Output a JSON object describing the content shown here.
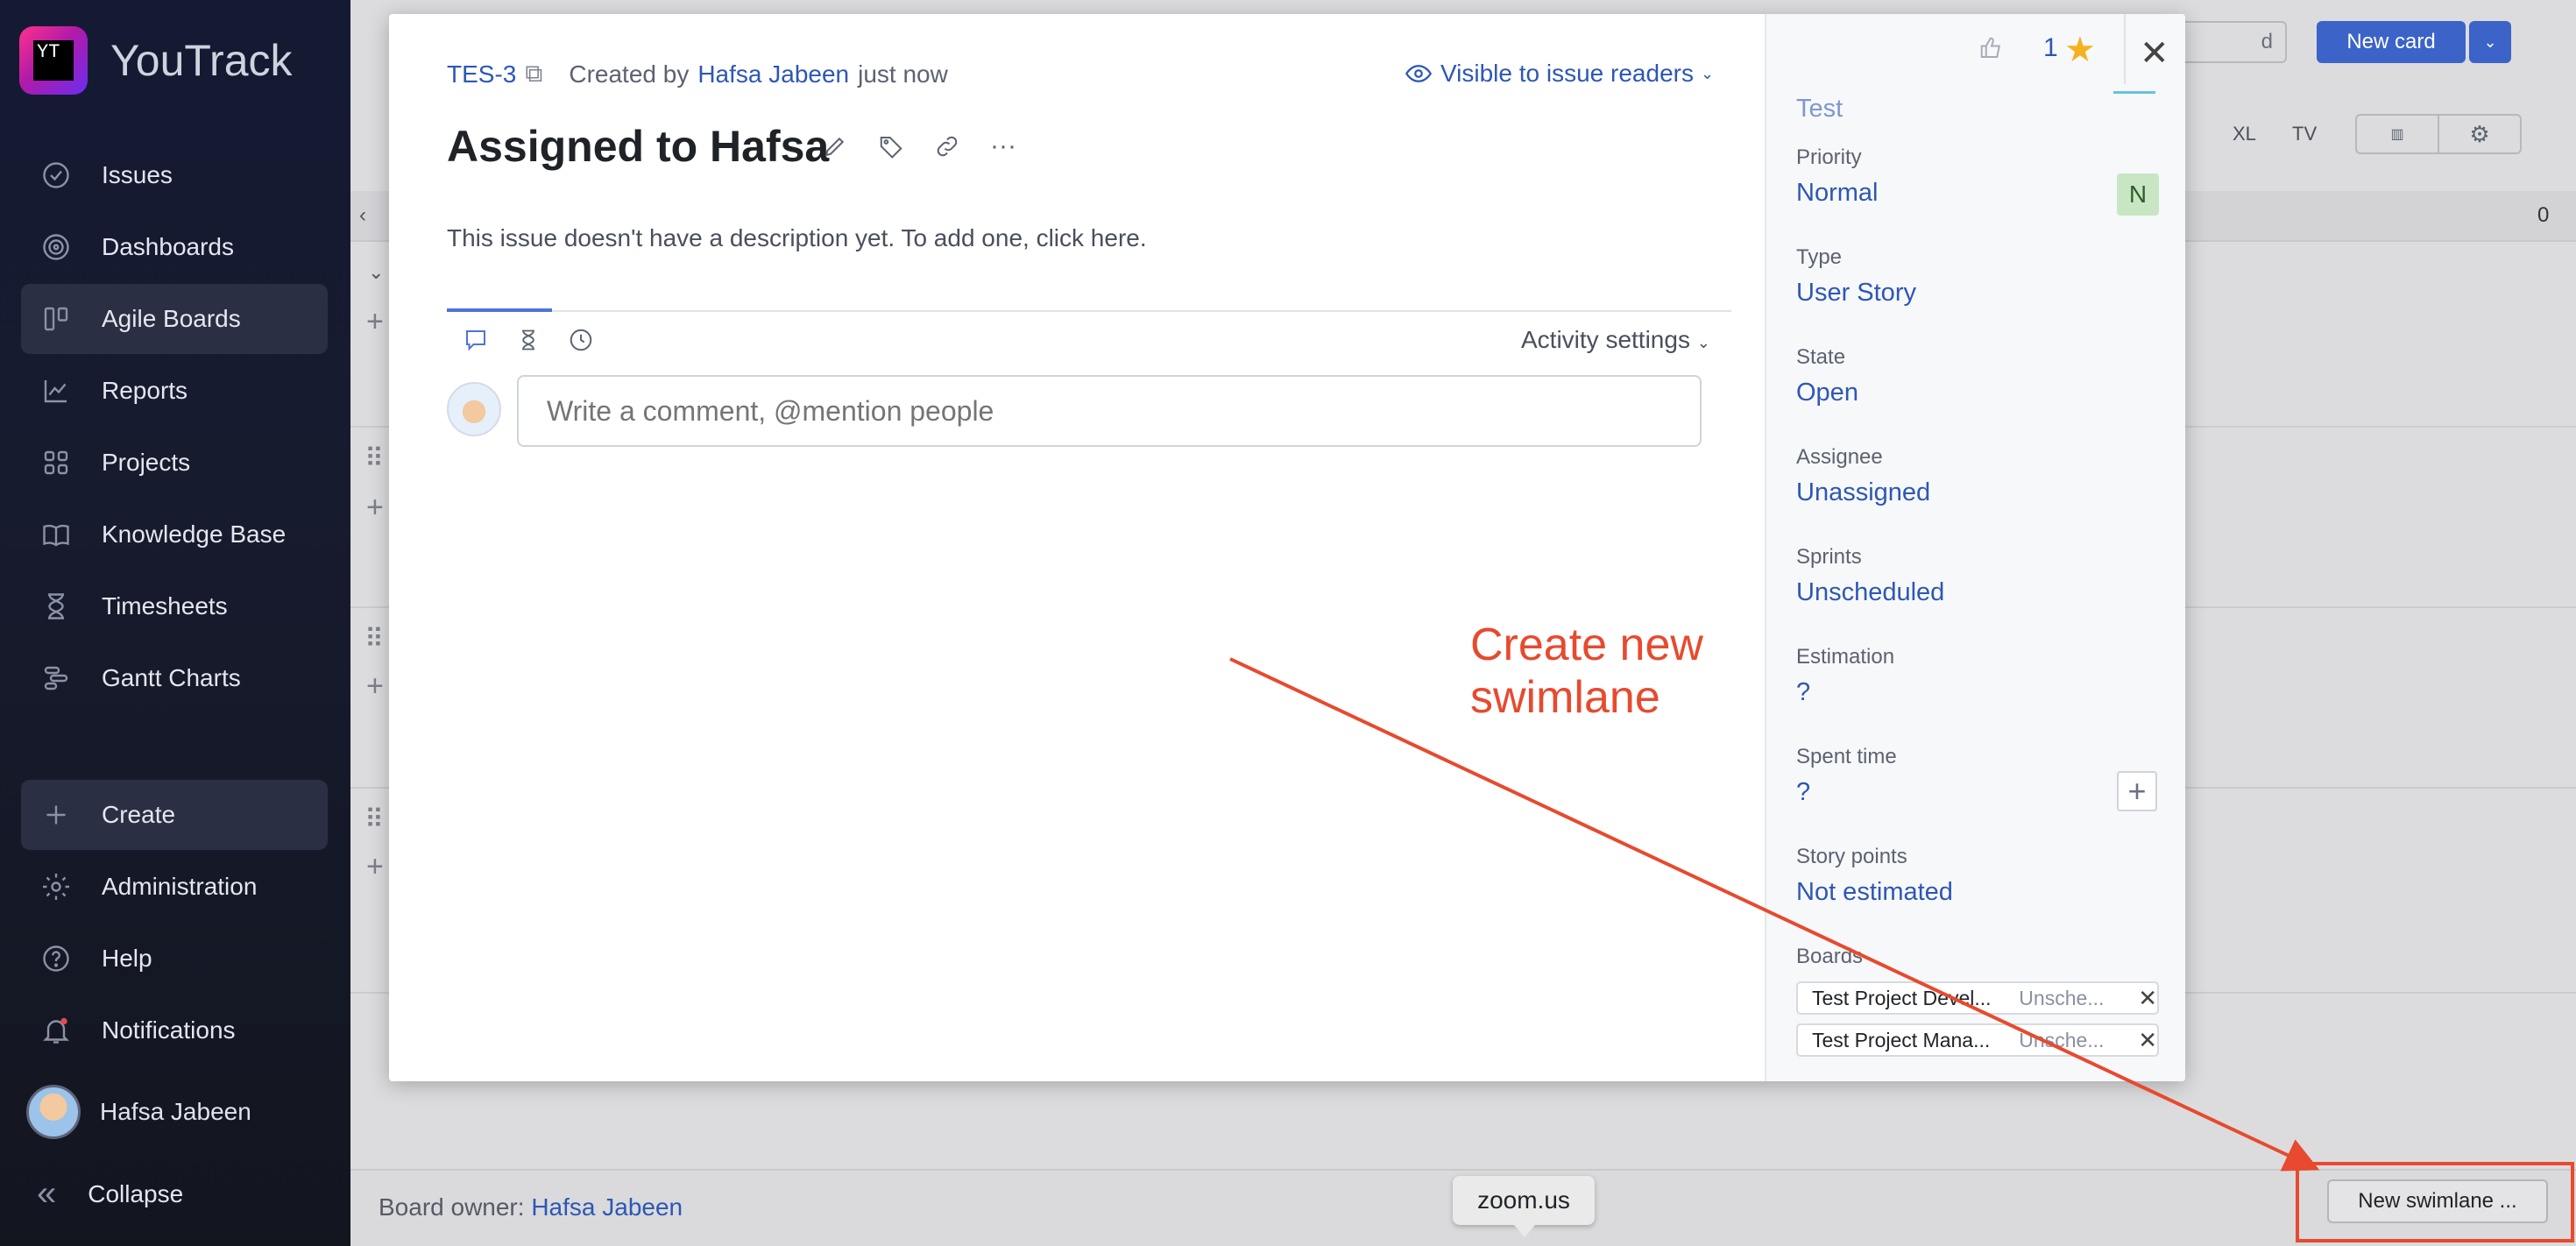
{
  "app": {
    "name": "YouTrack",
    "logo_text": "YT"
  },
  "sidebar": {
    "items": [
      {
        "label": "Issues",
        "icon": "check-circle-icon"
      },
      {
        "label": "Dashboards",
        "icon": "dashboard-icon"
      },
      {
        "label": "Agile Boards",
        "icon": "board-icon",
        "active": true
      },
      {
        "label": "Reports",
        "icon": "chart-icon"
      },
      {
        "label": "Projects",
        "icon": "grid-icon"
      },
      {
        "label": "Knowledge Base",
        "icon": "book-icon"
      },
      {
        "label": "Timesheets",
        "icon": "hourglass-icon"
      },
      {
        "label": "Gantt Charts",
        "icon": "gantt-icon"
      }
    ],
    "bottom": [
      {
        "label": "Create",
        "icon": "plus-icon"
      },
      {
        "label": "Administration",
        "icon": "gear-icon"
      },
      {
        "label": "Help",
        "icon": "help-icon"
      },
      {
        "label": "Notifications",
        "icon": "bell-icon"
      }
    ],
    "user": "Hafsa Jabeen",
    "collapse": "Collapse"
  },
  "board": {
    "new_card": "New card",
    "size_xl": "XL",
    "size_tv": "TV",
    "count": "0",
    "owner_label": "Board owner:",
    "owner_name": "Hafsa Jabeen",
    "new_swimlane": "New swimlane ...",
    "search_stub": "d"
  },
  "tooltip": {
    "text": "zoom.us"
  },
  "issue": {
    "id": "TES-3",
    "created_by_label": "Created by",
    "author": "Hafsa Jabeen",
    "created_when": "just now",
    "visibility": "Visible to issue readers",
    "title": "Assigned to Hafsa",
    "description": "This issue doesn't have a description yet. To add one, click here.",
    "activity_settings": "Activity settings",
    "comment_placeholder": "Write a comment, @mention people",
    "likes": "1"
  },
  "fields": {
    "top_partial": "Test",
    "priority": {
      "label": "Priority",
      "value": "Normal",
      "badge": "N"
    },
    "type": {
      "label": "Type",
      "value": "User Story"
    },
    "state": {
      "label": "State",
      "value": "Open"
    },
    "assignee": {
      "label": "Assignee",
      "value": "Unassigned"
    },
    "sprints": {
      "label": "Sprints",
      "value": "Unscheduled"
    },
    "estimation": {
      "label": "Estimation",
      "value": "?"
    },
    "spent_time": {
      "label": "Spent time",
      "value": "?"
    },
    "story_points": {
      "label": "Story points",
      "value": "Not estimated"
    },
    "boards": {
      "label": "Boards",
      "items": [
        {
          "name": "Test Project Devel...",
          "sprint": "Unsche..."
        },
        {
          "name": "Test Project Mana...",
          "sprint": "Unsche..."
        }
      ]
    }
  },
  "annotation": {
    "text": "Create new swimlane",
    "color": "#e74a2e"
  },
  "colors": {
    "accent": "#2d57b4",
    "button": "#3b63c8",
    "annotation": "#e74a2e"
  }
}
